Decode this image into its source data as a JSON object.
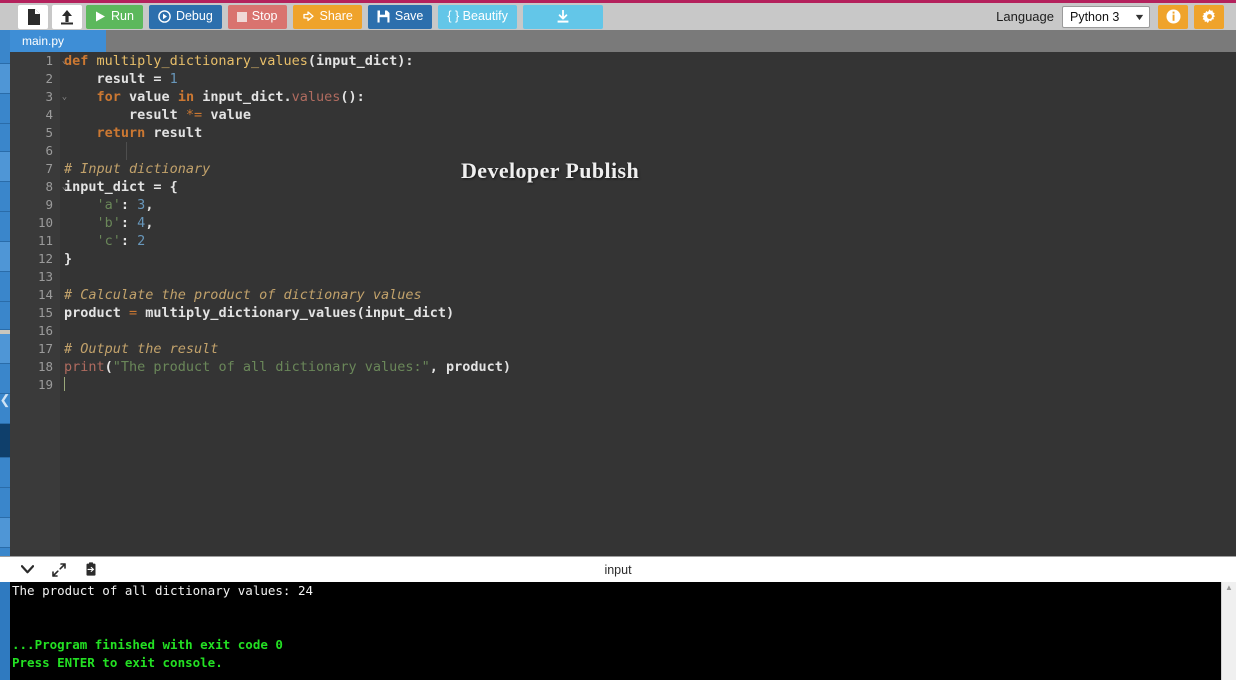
{
  "toolbar": {
    "buttons": [
      {
        "name": "new-file",
        "label": "",
        "icon": "file-icon"
      },
      {
        "name": "open-file",
        "label": "",
        "icon": "upload-icon"
      },
      {
        "name": "run",
        "label": "Run",
        "icon": "play-icon",
        "color": "#5cb85c"
      },
      {
        "name": "debug",
        "label": "Debug",
        "icon": "debug-icon",
        "color": "#2c6fad"
      },
      {
        "name": "stop",
        "label": "Stop",
        "icon": "stop-icon",
        "color": "#d9736f"
      },
      {
        "name": "share",
        "label": "Share",
        "icon": "share-icon",
        "color": "#efa32b"
      },
      {
        "name": "save",
        "label": "Save",
        "icon": "floppy-icon",
        "color": "#2c6fad"
      },
      {
        "name": "beautify",
        "label": "{ } Beautify",
        "icon": "braces-icon",
        "color": "#63c6e8"
      },
      {
        "name": "download",
        "label": "",
        "icon": "download-icon",
        "color": "#63c6e8"
      }
    ],
    "language_label": "Language",
    "language_value": "Python 3",
    "info_icon": "info-icon",
    "settings_icon": "gear-icon",
    "accent_top_border": "#b4215c"
  },
  "tabs": [
    {
      "label": "main.py",
      "active": true
    }
  ],
  "editor": {
    "watermark": "Developer Publish",
    "line_numbers": [
      "1",
      "2",
      "3",
      "4",
      "5",
      "6",
      "7",
      "8",
      "9",
      "10",
      "11",
      "12",
      "13",
      "14",
      "15",
      "16",
      "17",
      "18",
      "19"
    ],
    "fold_lines": [
      1,
      3,
      8
    ],
    "lines": [
      {
        "n": 1,
        "tokens": [
          {
            "t": "def ",
            "c": "kw"
          },
          {
            "t": "multiply_dictionary_values",
            "c": "fn"
          },
          {
            "t": "(input_dict):",
            "c": "pl"
          }
        ]
      },
      {
        "n": 2,
        "tokens": [
          {
            "t": "    result = ",
            "c": "pl"
          },
          {
            "t": "1",
            "c": "num"
          }
        ]
      },
      {
        "n": 3,
        "tokens": [
          {
            "t": "    ",
            "c": "pl"
          },
          {
            "t": "for",
            "c": "kw"
          },
          {
            "t": " value ",
            "c": "pl"
          },
          {
            "t": "in",
            "c": "kw"
          },
          {
            "t": " input_dict.",
            "c": "pl"
          },
          {
            "t": "values",
            "c": "meth"
          },
          {
            "t": "():",
            "c": "pl"
          }
        ]
      },
      {
        "n": 4,
        "tokens": [
          {
            "t": "        result ",
            "c": "pl"
          },
          {
            "t": "*=",
            "c": "op"
          },
          {
            "t": " value",
            "c": "pl"
          }
        ]
      },
      {
        "n": 5,
        "tokens": [
          {
            "t": "    ",
            "c": "pl"
          },
          {
            "t": "return",
            "c": "kw"
          },
          {
            "t": " result",
            "c": "pl"
          }
        ]
      },
      {
        "n": 6,
        "tokens": []
      },
      {
        "n": 7,
        "tokens": [
          {
            "t": "# Input dictionary",
            "c": "cm"
          }
        ]
      },
      {
        "n": 8,
        "tokens": [
          {
            "t": "input_dict = {",
            "c": "pl"
          }
        ]
      },
      {
        "n": 9,
        "tokens": [
          {
            "t": "    ",
            "c": "pl"
          },
          {
            "t": "'a'",
            "c": "str"
          },
          {
            "t": ": ",
            "c": "pl"
          },
          {
            "t": "3",
            "c": "num"
          },
          {
            "t": ",",
            "c": "pl"
          }
        ]
      },
      {
        "n": 10,
        "tokens": [
          {
            "t": "    ",
            "c": "pl"
          },
          {
            "t": "'b'",
            "c": "str"
          },
          {
            "t": ": ",
            "c": "pl"
          },
          {
            "t": "4",
            "c": "num"
          },
          {
            "t": ",",
            "c": "pl"
          }
        ]
      },
      {
        "n": 11,
        "tokens": [
          {
            "t": "    ",
            "c": "pl"
          },
          {
            "t": "'c'",
            "c": "str"
          },
          {
            "t": ": ",
            "c": "pl"
          },
          {
            "t": "2",
            "c": "num"
          }
        ]
      },
      {
        "n": 12,
        "tokens": [
          {
            "t": "}",
            "c": "pl"
          }
        ]
      },
      {
        "n": 13,
        "tokens": []
      },
      {
        "n": 14,
        "tokens": [
          {
            "t": "# Calculate the product of dictionary values",
            "c": "cm"
          }
        ]
      },
      {
        "n": 15,
        "tokens": [
          {
            "t": "product ",
            "c": "pl"
          },
          {
            "t": "=",
            "c": "op"
          },
          {
            "t": " multiply_dictionary_values(input_dict)",
            "c": "pl"
          }
        ]
      },
      {
        "n": 16,
        "tokens": []
      },
      {
        "n": 17,
        "tokens": [
          {
            "t": "# Output the result",
            "c": "cm"
          }
        ]
      },
      {
        "n": 18,
        "tokens": [
          {
            "t": "print",
            "c": "meth"
          },
          {
            "t": "(",
            "c": "pl"
          },
          {
            "t": "\"The product of all dictionary values:\"",
            "c": "str"
          },
          {
            "t": ", product)",
            "c": "pl"
          }
        ]
      },
      {
        "n": 19,
        "tokens": []
      }
    ]
  },
  "console_header": {
    "title": "input",
    "icons": [
      {
        "name": "chevron-down-icon"
      },
      {
        "name": "expand-arrows-icon"
      },
      {
        "name": "clipboard-paste-icon"
      }
    ]
  },
  "console": {
    "lines": [
      {
        "text": "The product of all dictionary values: 24",
        "style": "out"
      },
      {
        "text": "",
        "style": "out"
      },
      {
        "text": "",
        "style": "out"
      },
      {
        "text": "...Program finished with exit code 0",
        "style": "ok"
      },
      {
        "text": "Press ENTER to exit console.",
        "style": "ok"
      }
    ]
  }
}
